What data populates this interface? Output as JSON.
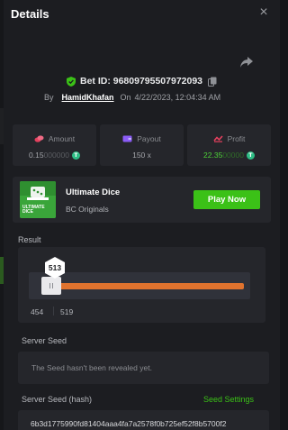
{
  "header": {
    "title": "Details",
    "close_glyph": "×"
  },
  "icons": {
    "share": "share-icon",
    "shield": "shield-check-icon",
    "copy": "copy-icon"
  },
  "bet": {
    "id_label": "Bet ID: 96809795507972093",
    "by_label": "By",
    "username": "HamidKhafan",
    "on_label": "On",
    "timestamp": "4/22/2023, 12:04:34 AM"
  },
  "stats": {
    "amount": {
      "label": "Amount",
      "value_main": "0.15",
      "value_dim": "000000",
      "coin": "T"
    },
    "payout": {
      "label": "Payout",
      "value": "150 x"
    },
    "profit": {
      "label": "Profit",
      "value_main": "22.35",
      "value_dim": "00000",
      "coin": "T"
    }
  },
  "game": {
    "thumb_text": "ULTIMATE DICE",
    "name": "Ultimate Dice",
    "provider": "BC Originals",
    "play_label": "Play Now"
  },
  "result": {
    "label": "Result",
    "roll": "513",
    "range_low": "454",
    "range_high": "519"
  },
  "server_seed": {
    "label": "Server Seed",
    "message": "The Seed hasn't been revealed yet."
  },
  "server_seed_hash": {
    "label": "Server Seed (hash)",
    "settings_label": "Seed Settings",
    "value": "6b3d1775990fd81404aaa4fa7a2578f0b725ef52f8b5700f2"
  },
  "colors": {
    "accent_green": "#3bc117",
    "profit_green": "#4cd137",
    "range_orange": "#e0732e",
    "coin_teal": "#2ebd85",
    "panel_bg": "#1c1d21",
    "card_bg": "#25262b"
  }
}
